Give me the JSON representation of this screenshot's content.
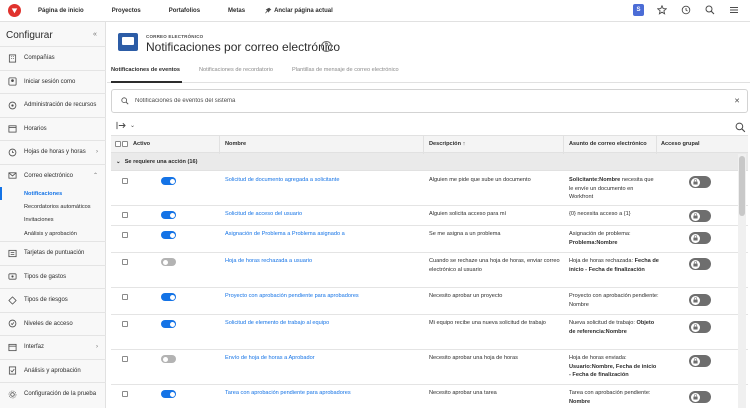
{
  "topnav": {
    "items": [
      "Página de inicio",
      "Proyectos",
      "Portafolios",
      "Metas"
    ],
    "pin_label": "Anclar página actual",
    "badge": "S"
  },
  "sidebar": {
    "title": "Configurar",
    "items": [
      {
        "label": "Compañías",
        "icon": "building-icon"
      },
      {
        "label": "Iniciar sesión como",
        "icon": "login-icon"
      },
      {
        "label": "Administración de recursos",
        "icon": "resource-icon"
      },
      {
        "label": "Horarios",
        "icon": "calendar-icon"
      },
      {
        "label": "Hojas de horas y horas",
        "icon": "clock-icon",
        "expandable": true
      },
      {
        "label": "Correo electrónico",
        "icon": "mail-icon",
        "expanded": true
      }
    ],
    "email_subitems": [
      "Notificaciones",
      "Recordatorios automáticos",
      "Invitaciones",
      "Análisis y aprobación"
    ],
    "items_after": [
      {
        "label": "Tarjetas de puntuación",
        "icon": "scorecard-icon"
      },
      {
        "label": "Tipos de gastos",
        "icon": "expense-icon"
      },
      {
        "label": "Tipos de riesgos",
        "icon": "risk-icon"
      },
      {
        "label": "Niveles de acceso",
        "icon": "access-icon"
      },
      {
        "label": "Interfaz",
        "icon": "interface-icon",
        "expandable": true
      },
      {
        "label": "Análisis y aprobación",
        "icon": "approval-icon"
      },
      {
        "label": "Configuración de la prueba",
        "icon": "settings-icon"
      }
    ]
  },
  "header": {
    "kicker": "CORREO ELECTRÓNICO",
    "title": "Notificaciones por correo electrónico"
  },
  "tabs": [
    "Notificaciones de eventos",
    "Notificaciones de recordatorio",
    "Plantillas de mensaje de correo electrónico"
  ],
  "search": {
    "placeholder": "Notificaciones de eventos del sistema"
  },
  "table": {
    "columns": [
      "Activo",
      "Nombre",
      "Descripción ↑",
      "Asunto de correo electrónico",
      "Acceso grupal"
    ],
    "group_label": "Se requiere una acción (16)",
    "rows": [
      {
        "active": true,
        "name": "Solicitud de documento agregada a solicitante",
        "desc": "Alguien me pide que sube un documento",
        "subject_bold": "Solicitante:Nombre",
        "subject_rest": " necesita que le envíe un documento en Workfront"
      },
      {
        "active": true,
        "name": "Solicitud de acceso del usuario",
        "desc": "Alguien solicita acceso para mí",
        "subject_bold": "",
        "subject_rest": "{0} necesita acceso a {1}"
      },
      {
        "active": true,
        "name": "Asignación de Problema a Problema asignado a",
        "desc": "Se me asigna a un problema",
        "subject_bold": "Problema:Nombre",
        "subject_rest": "Asignación de problema: "
      },
      {
        "active": false,
        "name": "Hoja de horas rechazada a usuario",
        "desc": "Cuando se rechaze una hoja de horas, enviar correo electrónico al usuario",
        "subject_bold": "Fecha de inicio - Fecha de finalización",
        "subject_rest": "Hoja de horas rechazada: "
      },
      {
        "active": true,
        "name": "Proyecto con aprobación pendiente para aprobadores",
        "desc": "Necesito aprobar un proyecto",
        "subject_bold": "",
        "subject_rest": "Proyecto con aprobación pendiente: Nombre"
      },
      {
        "active": true,
        "name": "Solicitud de elemento de trabajo al equipo",
        "desc": "Mi equipo recibe una nueva solicitud de trabajo",
        "subject_bold": "Objeto de referencia:Nombre",
        "subject_rest": "Nueva solicitud de trabajo: "
      },
      {
        "active": false,
        "name": "Envío de hoja de horas a Aprobador",
        "desc": "Necesito aprobar una hoja de horas",
        "subject_bold": "Usuario:Nombre, Fecha de inicio - Fecha de finalización",
        "subject_rest": "Hoja de horas enviada: "
      },
      {
        "active": true,
        "name": "Tarea con aprobación pendiente para aprobadores",
        "desc": "Necesito aprobar una tarea",
        "subject_bold": "Nombre",
        "subject_rest": "Tarea con aprobación pendiente: "
      }
    ]
  }
}
